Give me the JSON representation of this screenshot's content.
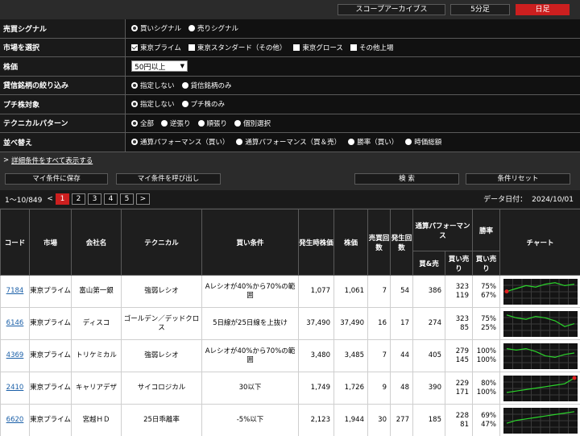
{
  "topbar": {
    "archive": "スコープアーカイブス",
    "interval": "5分足",
    "daily": "日足"
  },
  "filters": [
    {
      "label": "売買シグナル",
      "type": "radio",
      "options": [
        {
          "text": "買いシグナル",
          "on": true
        },
        {
          "text": "売りシグナル",
          "on": false
        }
      ]
    },
    {
      "label": "市場を選択",
      "type": "check",
      "options": [
        {
          "text": "東京プライム",
          "on": true
        },
        {
          "text": "東京スタンダード（その他）",
          "on": false
        },
        {
          "text": "東京グロース",
          "on": false
        },
        {
          "text": "その他上場",
          "on": false
        }
      ]
    },
    {
      "label": "株価",
      "type": "select",
      "value": "50円以上"
    },
    {
      "label": "貸信銘柄の絞り込み",
      "type": "radio",
      "options": [
        {
          "text": "指定しない",
          "on": true
        },
        {
          "text": "貸信銘柄のみ",
          "on": false
        }
      ]
    },
    {
      "label": "プチ株対象",
      "type": "radio",
      "options": [
        {
          "text": "指定しない",
          "on": true
        },
        {
          "text": "プチ株のみ",
          "on": false
        }
      ]
    },
    {
      "label": "テクニカルパターン",
      "type": "radio",
      "options": [
        {
          "text": "全部",
          "on": true
        },
        {
          "text": "逆張り",
          "on": false
        },
        {
          "text": "順張り",
          "on": false
        },
        {
          "text": "個別選択",
          "on": false
        }
      ]
    },
    {
      "label": "並べ替え",
      "type": "radio",
      "options": [
        {
          "text": "通算パフォーマンス（買い）",
          "on": true
        },
        {
          "text": "通算パフォーマンス（買＆売）",
          "on": false
        },
        {
          "text": "勝率（買い）",
          "on": false
        },
        {
          "text": "時価総額",
          "on": false
        }
      ]
    }
  ],
  "detail_link": "詳細条件をすべて表示する",
  "buttons": {
    "save": "マイ条件に保存",
    "load": "マイ条件を呼び出し",
    "search": "検 索",
    "reset": "条件リセット"
  },
  "pager": {
    "range": "1〜10/849",
    "pages": [
      "1",
      "2",
      "3",
      "4",
      "5"
    ],
    "prev": "<",
    "next": ">",
    "date_label": "データ日付：",
    "date": "2024/10/01"
  },
  "table": {
    "headers": {
      "code": "コード",
      "market": "市場",
      "company": "会社名",
      "technical": "テクニカル",
      "condition": "買い条件",
      "signal_price": "発生時株価",
      "price": "株価",
      "trade_count": "売買回数",
      "occ_count": "発生回数",
      "perf": "通算パフォーマンス",
      "perf_both": "買&売",
      "perf_buy": "買い売り",
      "win": "勝率",
      "win_buy": "買い売り",
      "chart": "チャート"
    },
    "rows": [
      {
        "code": "7184",
        "market": "東京プライム",
        "company": "富山第一銀",
        "technical": "強弱レシオ",
        "condition": "Aレシオが40%から70%の範囲",
        "signal_price": "1,077",
        "price": "1,061",
        "trades": "7",
        "occ": "54",
        "perf_both": "386",
        "perf_buy": "323",
        "perf_sell": "119",
        "win_buy": "75%",
        "win_sell": "67%",
        "spark": [
          8,
          10,
          12,
          11,
          13,
          14,
          12,
          13
        ],
        "dot": 0
      },
      {
        "code": "6146",
        "market": "東京プライム",
        "company": "ディスコ",
        "technical": "ゴールデン／デッドクロス",
        "condition": "5日線が25日線を上抜け",
        "signal_price": "37,490",
        "price": "37,490",
        "trades": "16",
        "occ": "17",
        "perf_both": "274",
        "perf_buy": "323",
        "perf_sell": "85",
        "win_buy": "75%",
        "win_sell": "25%",
        "spark": [
          14,
          12,
          11,
          13,
          12,
          10,
          6,
          8
        ],
        "dot": -1
      },
      {
        "code": "4369",
        "market": "東京プライム",
        "company": "トリケミカル",
        "technical": "強弱レシオ",
        "condition": "Aレシオが40%から70%の範囲",
        "signal_price": "3,480",
        "price": "3,485",
        "trades": "7",
        "occ": "44",
        "perf_both": "405",
        "perf_buy": "279",
        "perf_sell": "145",
        "win_buy": "100%",
        "win_sell": "100%",
        "spark": [
          13,
          12,
          13,
          11,
          8,
          7,
          9,
          10
        ],
        "dot": -1
      },
      {
        "code": "2410",
        "market": "東京プライム",
        "company": "キャリアデザ",
        "technical": "サイコロジカル",
        "condition": "30以下",
        "signal_price": "1,749",
        "price": "1,726",
        "trades": "9",
        "occ": "48",
        "perf_both": "390",
        "perf_buy": "229",
        "perf_sell": "171",
        "win_buy": "80%",
        "win_sell": "100%",
        "spark": [
          5,
          6,
          7,
          8,
          9,
          10,
          11,
          15
        ],
        "dot": 7
      },
      {
        "code": "6620",
        "market": "東京プライム",
        "company": "宮越ＨＤ",
        "technical": "25日乖離率",
        "condition": "-5%以下",
        "signal_price": "2,123",
        "price": "1,944",
        "trades": "30",
        "occ": "277",
        "perf_both": "185",
        "perf_buy": "228",
        "perf_sell": "81",
        "win_buy": "69%",
        "win_sell": "47%",
        "spark": [
          6,
          8,
          9,
          10,
          11,
          12,
          13,
          14
        ],
        "dot": -1
      }
    ]
  },
  "colors": {
    "accent": "#cc1f1f",
    "link": "#1a5fa8",
    "spark": "#2bd42b"
  }
}
